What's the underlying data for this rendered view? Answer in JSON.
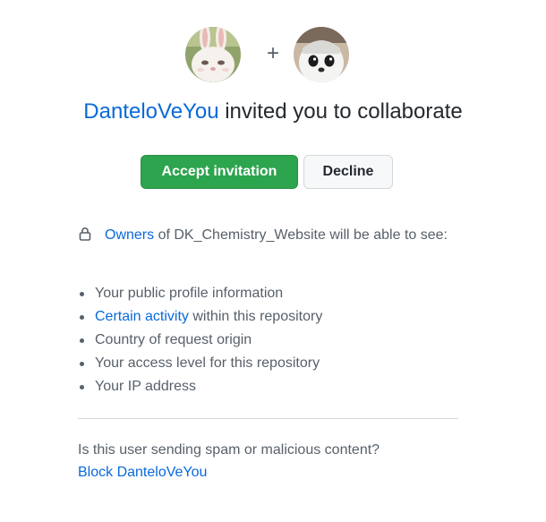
{
  "invitation": {
    "inviter_username": "DanteloVeYou",
    "headline_suffix": " invited you to collaborate",
    "plus_sign": "+",
    "accept_label": "Accept invitation",
    "decline_label": "Decline"
  },
  "notice": {
    "owners_link": "Owners",
    "text_before_repo": " of ",
    "repository": "DK_Chemistry_Website",
    "text_after_repo": " will be able to see:"
  },
  "permissions": [
    {
      "link": "",
      "text": "Your public profile information"
    },
    {
      "link": "Certain activity",
      "text": " within this repository"
    },
    {
      "link": "",
      "text": "Country of request origin"
    },
    {
      "link": "",
      "text": "Your access level for this repository"
    },
    {
      "link": "",
      "text": "Your IP address"
    }
  ],
  "spam": {
    "question": "Is this user sending spam or malicious content?",
    "block_link": "Block DanteloVeYou"
  },
  "colors": {
    "link": "#0969da",
    "primary_button": "#2da44e",
    "text": "#24292f",
    "muted": "#57606a"
  },
  "icons": {
    "lock": "lock-icon",
    "inviter_avatar": "bunny-avatar",
    "invitee_avatar": "cartoon-avatar"
  }
}
